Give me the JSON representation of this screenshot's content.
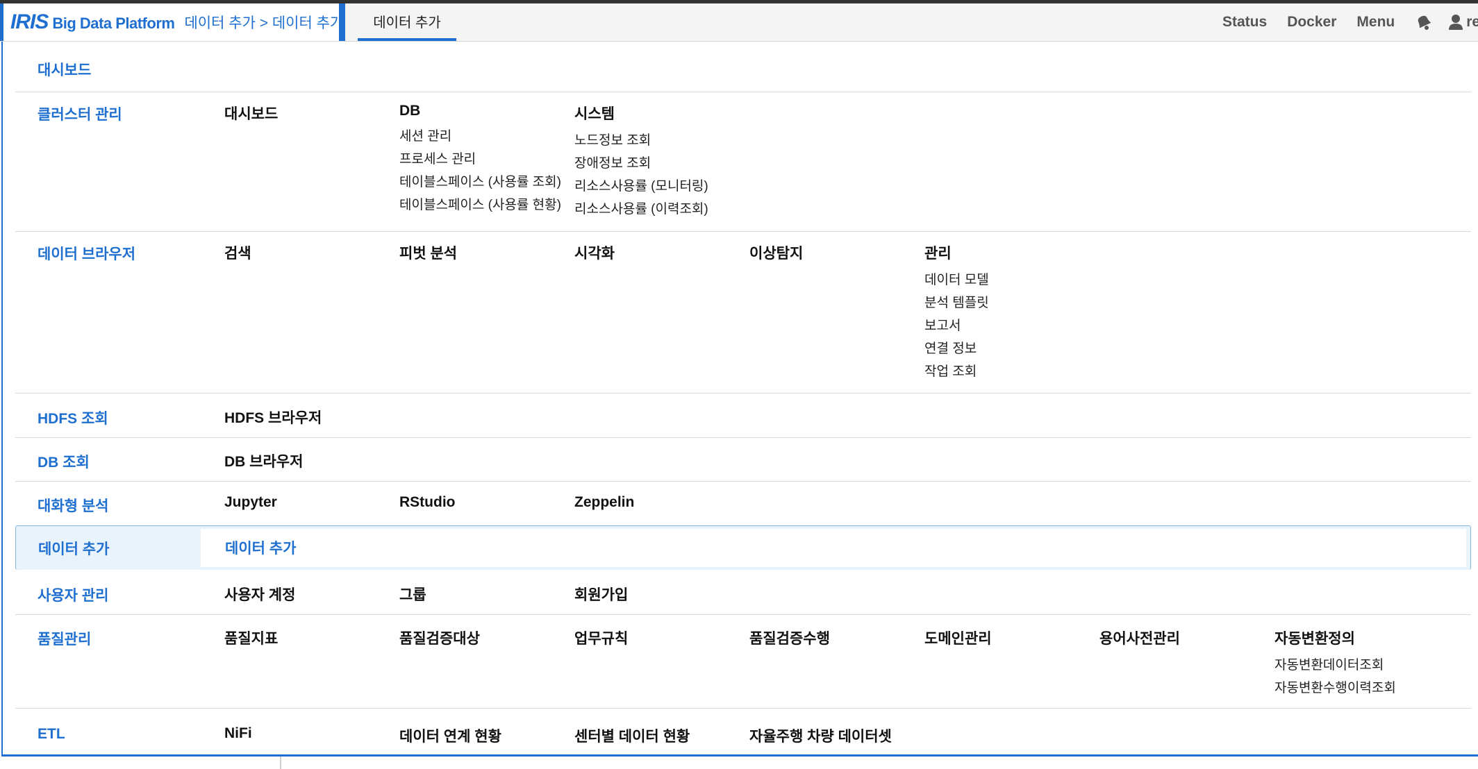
{
  "header": {
    "logo_iris": "IRIS",
    "logo_name": "Big Data Platform",
    "breadcrumb": "데이터 추가 > 데이터 추가",
    "active_tab": "데이터 추가",
    "nav": [
      "Status",
      "Docker",
      "Menu"
    ],
    "user_label": "re",
    "icons": [
      "notification-bell-icon",
      "user-icon"
    ]
  },
  "menu": {
    "dashboard": {
      "label": "대시보드"
    },
    "cluster": {
      "label": "클러스터 관리",
      "col_dashboard": "대시보드",
      "db": {
        "head": "DB",
        "items": [
          "세션 관리",
          "프로세스 관리",
          "테이블스페이스 (사용률 조회)",
          "테이블스페이스 (사용률 현황)"
        ]
      },
      "system": {
        "head": "시스템",
        "items": [
          "노드정보 조회",
          "장애정보 조회",
          "리소스사용률 (모니터링)",
          "리소스사용률 (이력조회)"
        ]
      }
    },
    "browser": {
      "label": "데이터 브라우저",
      "cols": [
        "검색",
        "피벗 분석",
        "시각화",
        "이상탐지"
      ],
      "manage": {
        "head": "관리",
        "items": [
          "데이터 모델",
          "분석 템플릿",
          "보고서",
          "연결 정보",
          "작업 조회"
        ]
      }
    },
    "hdfs": {
      "label": "HDFS 조회",
      "item": "HDFS 브라우저"
    },
    "db_query": {
      "label": "DB 조회",
      "item": "DB 브라우저"
    },
    "interactive": {
      "label": "대화형 분석",
      "cols": [
        "Jupyter",
        "RStudio",
        "Zeppelin"
      ]
    },
    "add_data": {
      "label": "데이터 추가",
      "item": "데이터 추가"
    },
    "users": {
      "label": "사용자 관리",
      "cols": [
        "사용자 계정",
        "그룹",
        "회원가입"
      ]
    },
    "quality": {
      "label": "품질관리",
      "cols": [
        "품질지표",
        "품질검증대상",
        "업무규칙",
        "품질검증수행",
        "도메인관리",
        "용어사전관리"
      ],
      "auto": {
        "head": "자동변환정의",
        "items": [
          "자동변환데이터조회",
          "자동변환수행이력조회"
        ]
      }
    },
    "etl": {
      "label": "ETL",
      "cols": [
        "NiFi",
        "데이터 연계 현황",
        "센터별 데이터 현황",
        "자율주행 차량 데이터셋"
      ]
    }
  },
  "colors": {
    "accent": "#1e6fd0",
    "highlight_bg": "#e9f3fc",
    "highlight_border": "#7fb7e6"
  }
}
